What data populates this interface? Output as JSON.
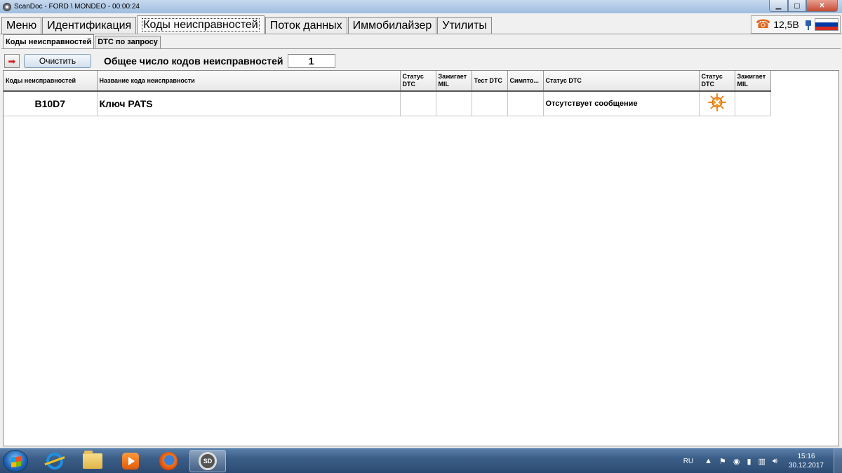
{
  "window": {
    "title": "ScanDoc - FORD \\ MONDEO - 00:00:24",
    "controls": {
      "minimize": "▁",
      "maximize": "▢",
      "close": "✕"
    }
  },
  "main_tabs": [
    {
      "label": "Меню",
      "active": false
    },
    {
      "label": "Идентификация",
      "active": false
    },
    {
      "label": "Коды неисправностей",
      "active": true
    },
    {
      "label": "Поток данных",
      "active": false
    },
    {
      "label": "Иммобилайзер",
      "active": false
    },
    {
      "label": "Утилиты",
      "active": false
    }
  ],
  "status": {
    "voltage": "12,5В",
    "icons": [
      "phone-icon",
      "plug-icon",
      "russia-flag-icon"
    ]
  },
  "sub_tabs": [
    {
      "label": "Коды неисправностей",
      "active": true
    },
    {
      "label": "DTC по запросу",
      "active": false
    }
  ],
  "toolbar": {
    "clear_label": "Очистить",
    "total_label": "Общее число кодов неисправностей",
    "total_value": "1"
  },
  "table": {
    "columns": [
      "Коды неисправностей",
      "Название кода неисправности",
      "Статус DTC",
      "Зажигает MIL",
      "Тест DTC",
      "Симпто...",
      "Статус DTC",
      "Статус DTC",
      "Зажигает MIL"
    ],
    "rows": [
      {
        "code": "B10D7",
        "name": "Ключ PATS",
        "status_dtc": "",
        "mil": "",
        "test_dtc": "",
        "symptom": "",
        "status_text": "Отсутствует сообщение",
        "status_icon": "error-sun-icon",
        "mil2": ""
      }
    ]
  },
  "taskbar": {
    "apps": [
      "windows-start",
      "internet-explorer-icon",
      "explorer-folder-icon",
      "media-player-icon",
      "firefox-icon",
      "scandoc-icon"
    ],
    "sd_icon_text": "SD",
    "language": "RU",
    "time": "15:16",
    "date": "30.12.2017"
  },
  "colors": {
    "accent_orange": "#e2661d",
    "flag_white": "#ffffff",
    "flag_blue": "#0039a6",
    "flag_red": "#d52b1e"
  }
}
